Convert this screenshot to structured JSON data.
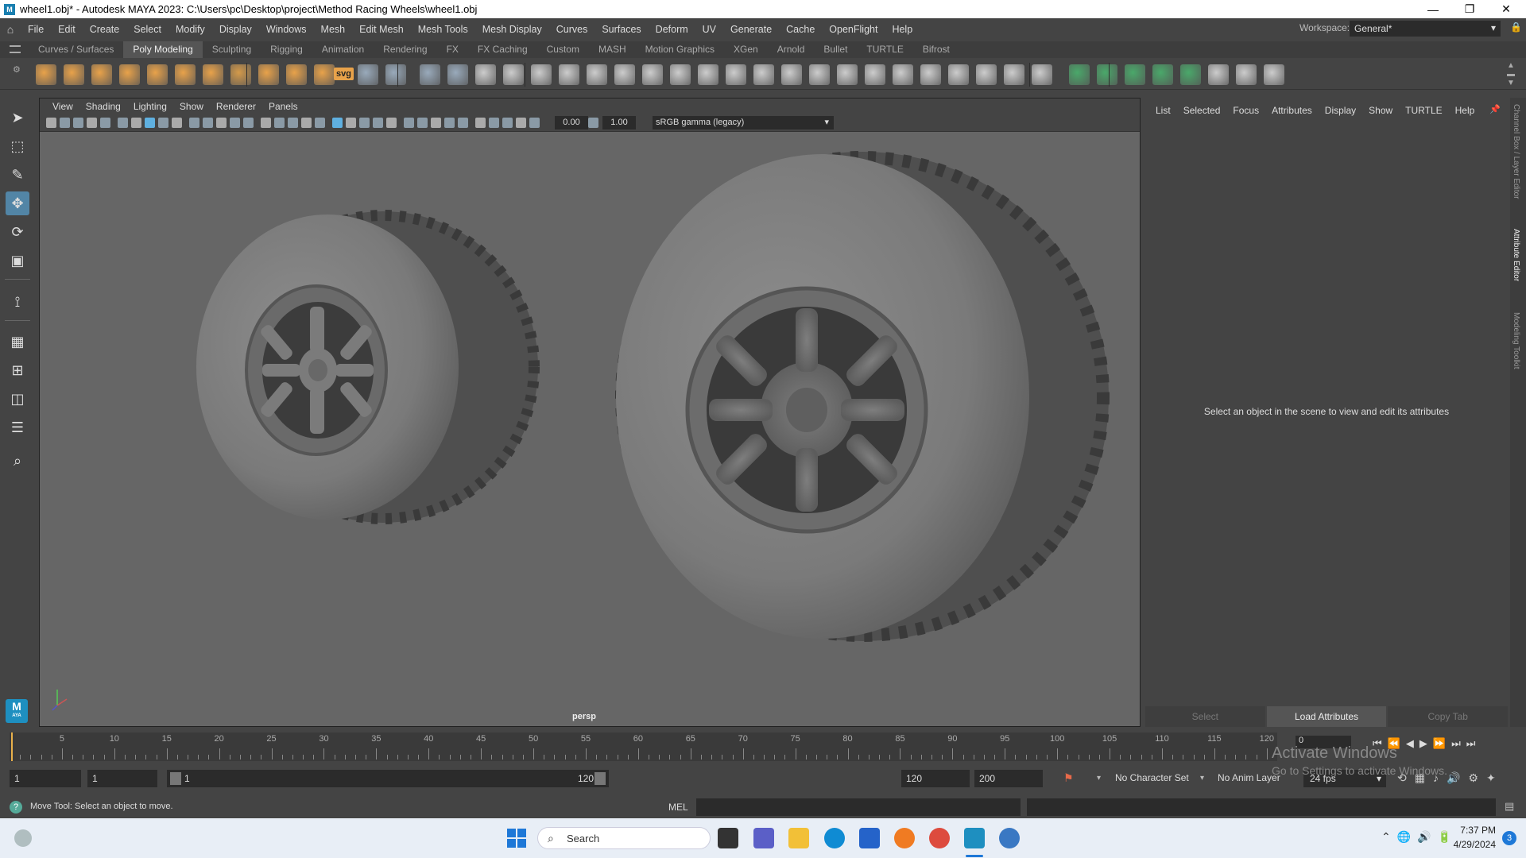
{
  "window": {
    "title": "wheel1.obj* - Autodesk MAYA 2023: C:\\Users\\pc\\Desktop\\project\\Method Racing Wheels\\wheel1.obj",
    "min": "—",
    "max": "❐",
    "close": "✕"
  },
  "menubar": [
    "File",
    "Edit",
    "Create",
    "Select",
    "Modify",
    "Display",
    "Windows",
    "Mesh",
    "Edit Mesh",
    "Mesh Tools",
    "Mesh Display",
    "Curves",
    "Surfaces",
    "Deform",
    "UV",
    "Generate",
    "Cache",
    "OpenFlight",
    "Help"
  ],
  "workspace": {
    "label": "Workspace:",
    "value": "General*"
  },
  "shelf_tabs": [
    "Curves / Surfaces",
    "Poly Modeling",
    "Sculpting",
    "Rigging",
    "Animation",
    "Rendering",
    "FX",
    "FX Caching",
    "Custom",
    "MASH",
    "Motion Graphics",
    "XGen",
    "Arnold",
    "Bullet",
    "TURTLE",
    "Bifrost"
  ],
  "shelf_active": "Poly Modeling",
  "shelf_svg_label": "svg",
  "viewport": {
    "menu": [
      "View",
      "Shading",
      "Lighting",
      "Show",
      "Renderer",
      "Panels"
    ],
    "exposure": "0.00",
    "gamma": "1.00",
    "colorspace": "sRGB gamma (legacy)",
    "camera": "persp"
  },
  "right_panel": {
    "menu": [
      "List",
      "Selected",
      "Focus",
      "Attributes",
      "Display",
      "Show",
      "TURTLE",
      "Help"
    ],
    "message": "Select an object in the scene to view and edit its attributes",
    "buttons": [
      "Select",
      "Load Attributes",
      "Copy Tab"
    ]
  },
  "side_tabs": [
    "Channel Box / Layer Editor",
    "Attribute Editor",
    "Modeling Toolkit"
  ],
  "timeline": {
    "ticks": [
      "5",
      "10",
      "15",
      "20",
      "25",
      "30",
      "35",
      "40",
      "45",
      "50",
      "55",
      "60",
      "65",
      "70",
      "75",
      "80",
      "85",
      "90",
      "95",
      "100",
      "105",
      "110",
      "115",
      "120"
    ],
    "current_frame": "0"
  },
  "range": {
    "start": "1",
    "playback_start": "1",
    "slider_start": "1",
    "slider_end": "120",
    "playback_end": "120",
    "end": "200",
    "character_set": "No Character Set",
    "anim_layer": "No Anim Layer",
    "fps": "24 fps"
  },
  "status": {
    "help": "Move Tool: Select an object to move.",
    "mel_label": "MEL"
  },
  "watermark": {
    "line1": "Activate Windows",
    "line2": "Go to Settings to activate Windows."
  },
  "taskbar": {
    "search_placeholder": "Search",
    "time": "7:37 PM",
    "date": "4/29/2024",
    "notification_count": "3"
  },
  "maya_badge": "M",
  "maya_badge_sub": "AYA",
  "colors": {
    "accent": "#5285a6",
    "viewport_bg": "#666666",
    "panel_bg": "#444444"
  }
}
